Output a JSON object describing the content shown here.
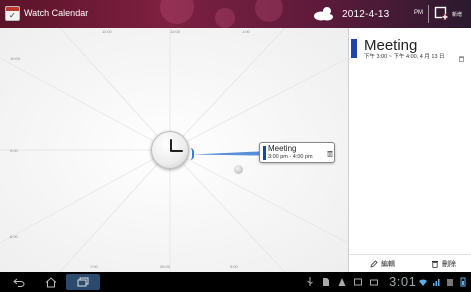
{
  "app": {
    "title": "Watch Calendar",
    "icon": "calendar-icon"
  },
  "topbar": {
    "weather_icon": "cloud-sun-icon",
    "date": "2012-4-13",
    "ampm": "PM",
    "add_icon": "add-event-icon",
    "add_label": "新增"
  },
  "watch": {
    "hour_labels": {
      "top": [
        "11:00",
        "12:00",
        "1:00"
      ],
      "left": [
        "10:00",
        "9:00",
        "8:00"
      ],
      "bottom": [
        "7:00",
        "06:00",
        "5:00"
      ]
    },
    "event_card": {
      "title": "Meeting",
      "time": "3:00 pm - 4:00 pm"
    }
  },
  "detail": {
    "title": "Meeting",
    "time": "下午 3:00 ~ 下午 4:00, 4 月 13 日",
    "edit_label": "編輯",
    "delete_label": "刪除"
  },
  "statusbar": {
    "clock": "3:01"
  },
  "colors": {
    "accent_blue": "#1f45a8",
    "topbar": "#7e2041"
  }
}
